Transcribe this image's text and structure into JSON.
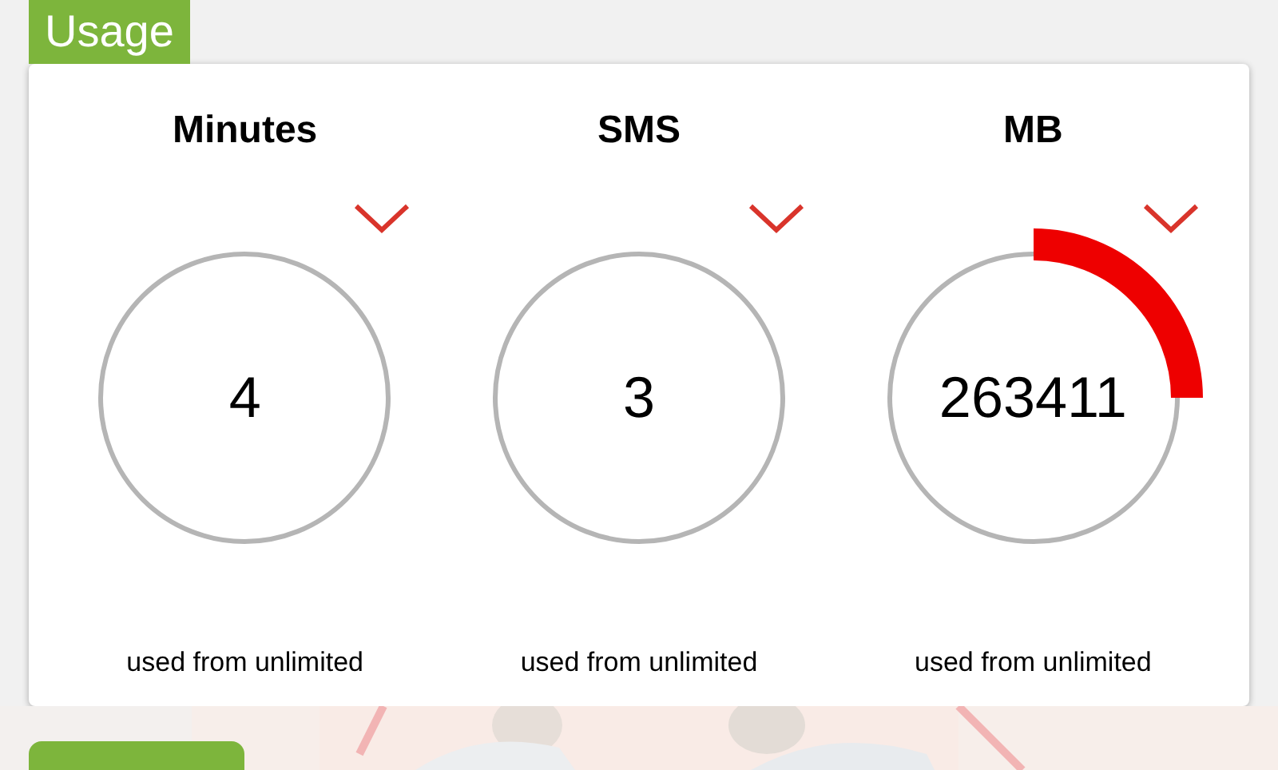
{
  "section_title": "Usage",
  "meters": [
    {
      "title": "Minutes",
      "value": "4",
      "caption": "used from unlimited"
    },
    {
      "title": "SMS",
      "value": "3",
      "caption": "used from unlimited"
    },
    {
      "title": "MB",
      "value": "263411",
      "level": 0.25,
      "caption": "used from unlimited"
    }
  ]
}
